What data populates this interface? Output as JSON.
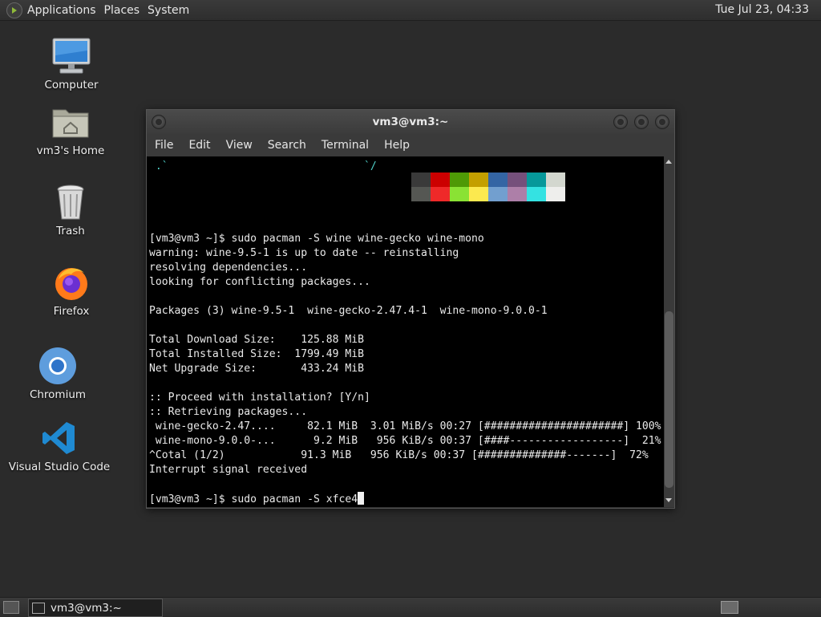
{
  "top_panel": {
    "menus": [
      "Applications",
      "Places",
      "System"
    ],
    "clock": "Tue Jul 23, 04:33"
  },
  "desktop_icons": [
    {
      "label": "Computer",
      "icon": "computer-icon"
    },
    {
      "label": "vm3's Home",
      "icon": "home-folder-icon"
    },
    {
      "label": "Trash",
      "icon": "trash-icon"
    },
    {
      "label": "Firefox",
      "icon": "firefox-icon"
    },
    {
      "label": "Chromium",
      "icon": "chromium-icon"
    },
    {
      "label": "Visual Studio Code",
      "icon": "vscode-icon"
    }
  ],
  "terminal": {
    "title": "vm3@vm3:~",
    "menus": [
      "File",
      "Edit",
      "View",
      "Search",
      "Terminal",
      "Help"
    ],
    "lines": [
      " .`                               `/",
      "",
      "",
      "",
      "",
      "[vm3@vm3 ~]$ sudo pacman -S wine wine-gecko wine-mono",
      "warning: wine-9.5-1 is up to date -- reinstalling",
      "resolving dependencies...",
      "looking for conflicting packages...",
      "",
      "Packages (3) wine-9.5-1  wine-gecko-2.47.4-1  wine-mono-9.0.0-1",
      "",
      "Total Download Size:    125.88 MiB",
      "Total Installed Size:  1799.49 MiB",
      "Net Upgrade Size:       433.24 MiB",
      "",
      ":: Proceed with installation? [Y/n]",
      ":: Retrieving packages...",
      " wine-gecko-2.47....     82.1 MiB  3.01 MiB/s 00:27 [######################] 100%",
      " wine-mono-9.0.0-...      9.2 MiB   956 KiB/s 00:37 [####------------------]  21%",
      "^Cotal (1/2)            91.3 MiB   956 KiB/s 00:37 [##############-------]  72%",
      "Interrupt signal received",
      "",
      "[vm3@vm3 ~]$ sudo pacman -S xfce4"
    ],
    "palette_top": [
      "#3a3a3a",
      "#cc0000",
      "#4e9a06",
      "#c4a000",
      "#3465a4",
      "#75507b",
      "#06989a",
      "#d3d7cf"
    ],
    "palette_bottom": [
      "#555753",
      "#ef2929",
      "#8ae234",
      "#fce94f",
      "#729fcf",
      "#ad7fa8",
      "#34e2e2",
      "#eeeeec"
    ]
  },
  "taskbar": {
    "task_label": "vm3@vm3:~"
  },
  "colors": {
    "desktop_bg": "#2b2b2b",
    "panel_bg": "#353535",
    "terminal_bg": "#000000"
  }
}
